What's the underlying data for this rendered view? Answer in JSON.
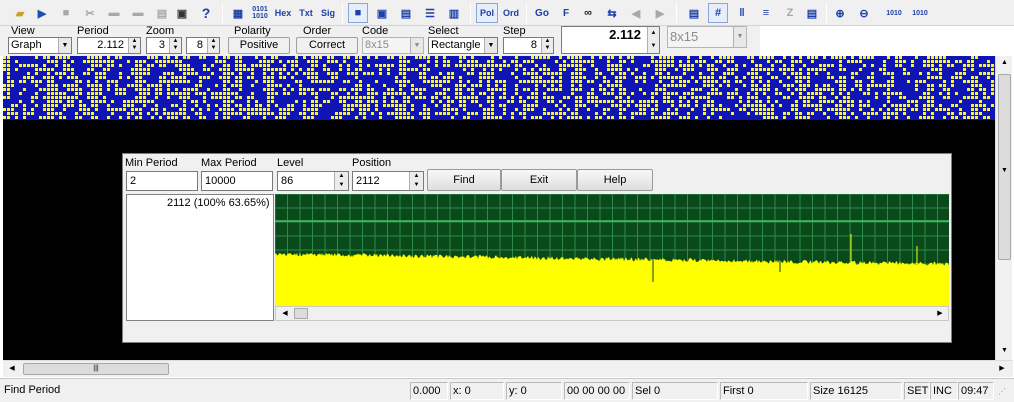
{
  "toolbar": {
    "buttons": [
      {
        "name": "open-icon",
        "glyph": "▰"
      },
      {
        "name": "open-folder-icon",
        "glyph": "▰"
      },
      {
        "name": "save-icon",
        "glyph": "▪"
      },
      {
        "name": "cut-icon",
        "glyph": "✂"
      },
      {
        "name": "copy-icon",
        "glyph": "▪"
      },
      {
        "name": "paste-icon",
        "glyph": "▪"
      },
      {
        "name": "clipboard-icon",
        "glyph": "▪"
      },
      {
        "name": "screenshot-icon",
        "glyph": "▣"
      },
      {
        "name": "help-icon",
        "glyph": "?"
      }
    ],
    "mode_buttons": {
      "bin": "0101 1010",
      "hex": "Hex",
      "txt": "Txt",
      "sig": "Sig"
    },
    "pol": "Pol",
    "ord": "Ord",
    "go": "Go",
    "f": "F"
  },
  "controls": {
    "view": {
      "label": "View",
      "value": "Graph"
    },
    "period": {
      "label": "Period",
      "value": "2.112"
    },
    "zoom": {
      "label": "Zoom",
      "value_a": "3",
      "value_b": "8"
    },
    "polarity": {
      "label": "Polarity",
      "value": "Positive"
    },
    "order": {
      "label": "Order",
      "value": "Correct"
    },
    "code": {
      "label": "Code",
      "value": "8x15"
    },
    "select": {
      "label": "Select",
      "value": "Rectangle"
    },
    "step": {
      "label": "Step",
      "value": "8"
    },
    "big_value": "2.112",
    "font_combo": "8x15"
  },
  "dialog": {
    "min_period_label": "Min Period",
    "min_period_value": "2",
    "max_period_label": "Max Period",
    "max_period_value": "10000",
    "level_label": "Level",
    "level_value": "86",
    "position_label": "Position",
    "position_value": "2112",
    "find_label": "Find",
    "exit_label": "Exit",
    "help_label": "Help",
    "result": "2112 (100% 63.65%)"
  },
  "status": {
    "message": "Find Period",
    "value": "0.000",
    "x": "x: 0",
    "y": "y: 0",
    "bytes": "00 00 00 00",
    "sel": "Sel 0",
    "first": "First 0",
    "size": "Size 16125",
    "set": "SET",
    "inc": "INC",
    "time": "09:47"
  },
  "colors": {
    "grid_blue": "#0f14b5",
    "grid_yellow": "#f5f24a",
    "graph_green": "#0a4a1a",
    "graph_yellow": "#ffff00"
  }
}
